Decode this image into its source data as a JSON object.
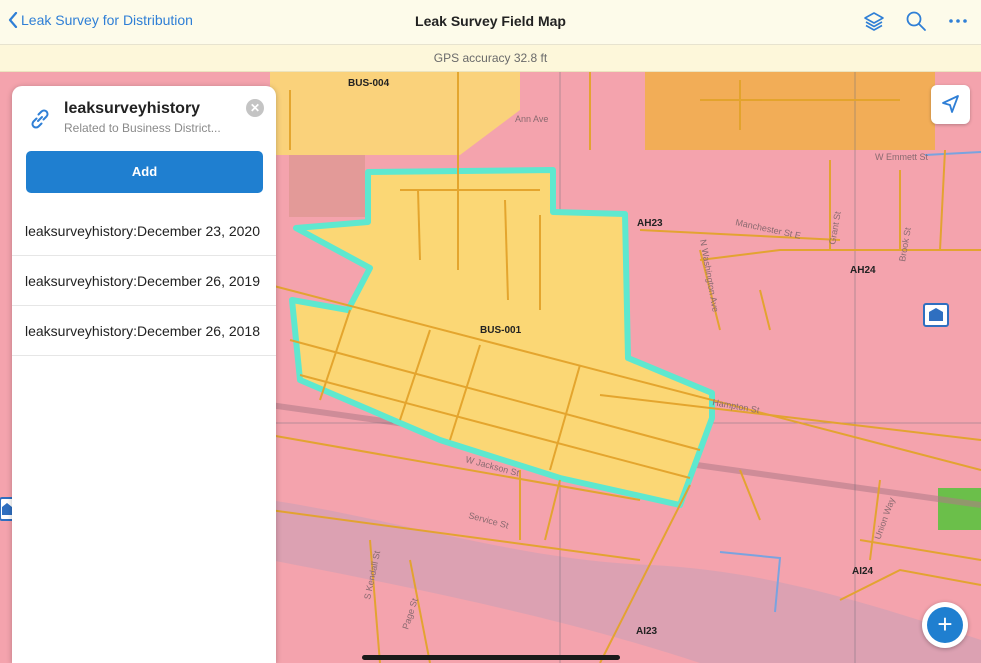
{
  "header": {
    "back_label": "Leak Survey for Distribution",
    "title": "Leak Survey Field Map",
    "icons": [
      "layers-icon",
      "search-icon",
      "more-icon"
    ]
  },
  "gps": {
    "text": "GPS accuracy 32.8 ft"
  },
  "panel": {
    "title": "leaksurveyhistory",
    "subtitle": "Related to Business District...",
    "add_label": "Add",
    "items": [
      {
        "label": "leaksurveyhistory:December 23, 2020"
      },
      {
        "label": "leaksurveyhistory:December 26, 2019"
      },
      {
        "label": "leaksurveyhistory:December 26, 2018"
      }
    ]
  },
  "map": {
    "zone_labels": {
      "bus004": "BUS-004",
      "bus001": "BUS-001",
      "ah23": "AH23",
      "ah24": "AH24",
      "ai24": "AI24",
      "ai23": "AI23"
    },
    "streets": {
      "ann": "Ann Ave",
      "manchester": "Manchester St E",
      "washington": "N Washington Ave",
      "emmett": "W Emmett St",
      "jackson": "W Jackson St",
      "service": "Service St",
      "hampton": "Hampton St",
      "kendall": "S Kendall St",
      "page": "Page St",
      "grant": "Grant St",
      "brook": "Brook St",
      "union": "Union Way"
    },
    "colors": {
      "background": "#f4a3ad",
      "selected_zone": "#fbd775",
      "highlight": "#5ee8cf",
      "lines": "#e3a32b"
    }
  },
  "buttons": {
    "fab_label": "+"
  }
}
